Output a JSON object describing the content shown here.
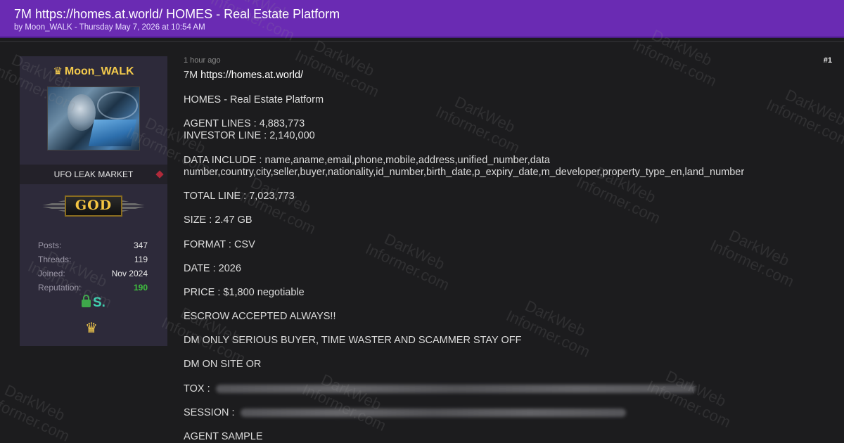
{
  "thread": {
    "title": "7M https://homes.at.world/ HOMES - Real Estate Platform",
    "byline": "by Moon_WALK - Thursday May 7, 2026 at 10:54 AM"
  },
  "user": {
    "name": "Moon_WALK",
    "group": "UFO LEAK MARKET",
    "rank": "GOD",
    "stats": [
      {
        "label": "Posts:",
        "value": "347"
      },
      {
        "label": "Threads:",
        "value": "119"
      },
      {
        "label": "Joined:",
        "value": "Nov 2024"
      },
      {
        "label": "Reputation:",
        "value": "190"
      }
    ],
    "reputation_color": "#3fbf3f",
    "icons": [
      "crown-icon",
      "lock-icon",
      "s-badge-icon",
      "avatar-image"
    ]
  },
  "post": {
    "time": "1 hour ago",
    "number": "#1",
    "lines": {
      "l1_prefix": "7M ",
      "l1_link": "https://homes.at.world/",
      "l2": "HOMES - Real Estate Platform",
      "l3": "AGENT LINES : 4,883,773",
      "l4": "INVESTOR LINE : 2,140,000",
      "l5": "DATA INCLUDE : name,aname,email,phone,mobile,address,unified_number,data",
      "l6": "number,country,city,seller,buyer,nationality,id_number,birth_date,p_expiry_date,m_developer,property_type_en,land_number",
      "l7": "TOTAL LINE : 7,023,773",
      "l8": "SIZE : 2.47 GB",
      "l9": "FORMAT : CSV",
      "l10": "DATE : 2026",
      "l11": "PRICE : $1,800 negotiable",
      "l12": "ESCROW ACCEPTED ALWAYS!!",
      "l13": "DM ONLY SERIOUS BUYER, TIME WASTER AND SCAMMER STAY OFF",
      "l14": "DM ON SITE OR",
      "l15": "TOX :",
      "l16": "SESSION :",
      "l17": "AGENT SAMPLE"
    }
  },
  "watermark": {
    "line1": "DarkWeb",
    "line2": "Informer.com"
  },
  "colors": {
    "header": "#6a2bb3",
    "username": "#f2c94c",
    "background": "#1c1c1e"
  }
}
